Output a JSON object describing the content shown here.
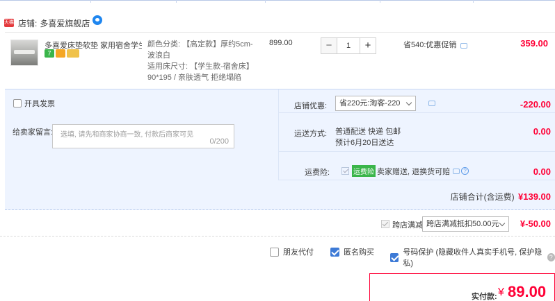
{
  "shop": {
    "tmall_badge": "天猫",
    "label": "店铺:",
    "name": "多喜爱旗舰店"
  },
  "item": {
    "title": "多喜爱床垫软垫 家用宿舍学生...",
    "badge_7": "7",
    "sku_line1": "颜色分类: 【高定款】厚约5cm-",
    "sku_line2": "波浪白",
    "sku_line3": "适用床尺寸: 【学生款-宿舍床】",
    "sku_line4": "90*195 / 亲肤透气 拒绝塌陷",
    "unit_price": "899.00",
    "quantity": "1",
    "minus": "−",
    "plus": "+",
    "promo": "省540:优惠促销",
    "subtotal": "359.00"
  },
  "invoice": {
    "label": "开具发票"
  },
  "message": {
    "label": "给卖家留言:",
    "placeholder": "选填, 请先和商家协商一致, 付款后商家可见",
    "counter": "0/200"
  },
  "shop_discount": {
    "label": "店铺优惠:",
    "selected": "省220元:淘客-220",
    "value": "-220.00"
  },
  "shipping": {
    "label": "运送方式:",
    "line1": "普通配送 快递 包邮",
    "line2": "预计6月20日送达",
    "value": "0.00"
  },
  "insurance": {
    "label": "运费险:",
    "tag": "运费险",
    "text": "卖家赠送, 退换货可赔",
    "value": "0.00"
  },
  "shop_total": {
    "label": "店铺合计(含运费)",
    "value": "¥139.00"
  },
  "cross_store": {
    "label": "跨店满减",
    "selected": "跨店满减抵扣50.00元",
    "value": "¥-50.00"
  },
  "options": {
    "friend_pay": "朋友代付",
    "anonymous": "匿名购买",
    "number_protect": "号码保护 (隐藏收件人真实手机号, 保护隐私)"
  },
  "payment": {
    "label": "实付款:",
    "currency": "¥",
    "amount": "89.00"
  },
  "colors": {
    "accent": "#ff0036",
    "panel_bg": "#eef4ff",
    "check_blue": "#3d7ad6",
    "insurance_green": "#3ab54a"
  },
  "icons": [
    "tmall-badge-icon",
    "wangwang-icon",
    "chat-icon",
    "help-icon",
    "chevron-down-icon"
  ]
}
